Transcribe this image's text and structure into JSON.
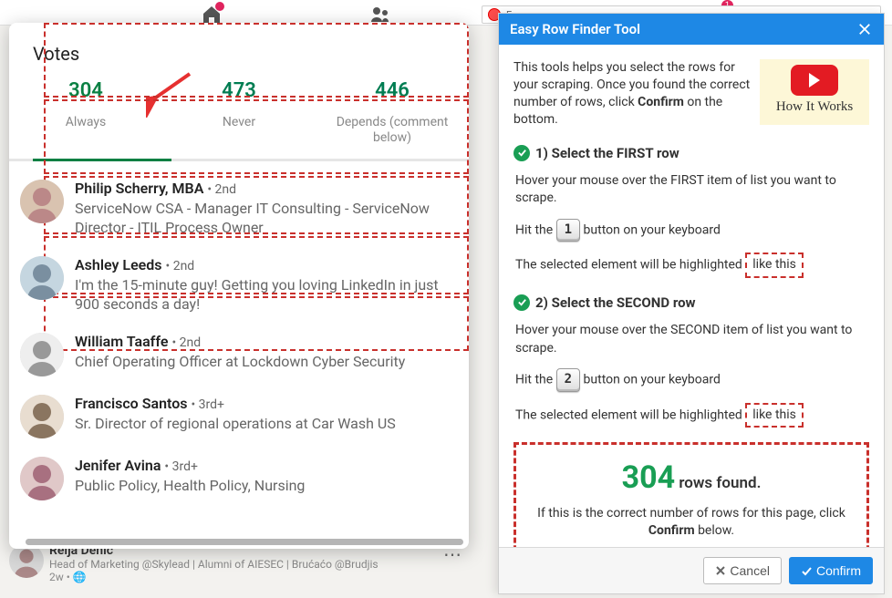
{
  "topnav": {
    "home_badge": "",
    "msg_badge": "1"
  },
  "votes": {
    "title": "Votes",
    "tabs": [
      {
        "count": "304",
        "label": "Always"
      },
      {
        "count": "473",
        "label": "Never"
      },
      {
        "count": "446",
        "label": "Depends (comment below)"
      }
    ]
  },
  "people": [
    {
      "name": "Philip Scherry, MBA",
      "degree": "• 2nd",
      "sub": "ServiceNow CSA - Manager IT Consulting - ServiceNow Director - ITIL Process Owner"
    },
    {
      "name": "Ashley Leeds",
      "degree": "• 2nd",
      "sub": "I'm the 15-minute guy! Getting you loving LinkedIn in just 900 seconds a day!"
    },
    {
      "name": "William Taaffe",
      "degree": "• 2nd",
      "sub": "Chief Operating Officer at Lockdown Cyber Security"
    },
    {
      "name": "Francisco Santos",
      "degree": "• 3rd+",
      "sub": "Sr. Director of regional operations at Car Wash US"
    },
    {
      "name": "Jenifer Avina",
      "degree": "• 3rd+",
      "sub": "Public Policy, Health Policy, Nursing"
    }
  ],
  "feed": {
    "name": "Relja Denić",
    "sub": "Head of Marketing @Skylead | Alumni of AIESEC | Brućaćo @Brudjis",
    "time": "2w • "
  },
  "record": {
    "label": "F"
  },
  "tool": {
    "header": "Easy Row Finder Tool",
    "intro": "This tools helps you select the rows for your scraping. Once you found the correct number of rows, click ",
    "intro_bold": "Confirm",
    "intro_after": " on the bottom.",
    "howit": "How It Works",
    "step1": {
      "title": "1) Select the FIRST row",
      "line1": "Hover your mouse over the FIRST item of list you want to scrape.",
      "line2a": "Hit the ",
      "key": "1",
      "line2b": " button on your keyboard",
      "line3a": "The selected element will be highlighted ",
      "like": "like this"
    },
    "step2": {
      "title": "2) Select the SECOND row",
      "line1": "Hover your mouse over the SECOND item of list you want to scrape.",
      "line2a": "Hit the ",
      "key": "2",
      "line2b": " button on your keyboard",
      "line3a": "The selected element will be highlighted ",
      "like": "like this"
    },
    "result": {
      "count": "304",
      "label": " rows found.",
      "sub_a": "If this is the correct number of rows for this page, click ",
      "sub_bold": "Confirm",
      "sub_b": " below."
    },
    "cancel": "Cancel",
    "confirm": "Confirm"
  }
}
